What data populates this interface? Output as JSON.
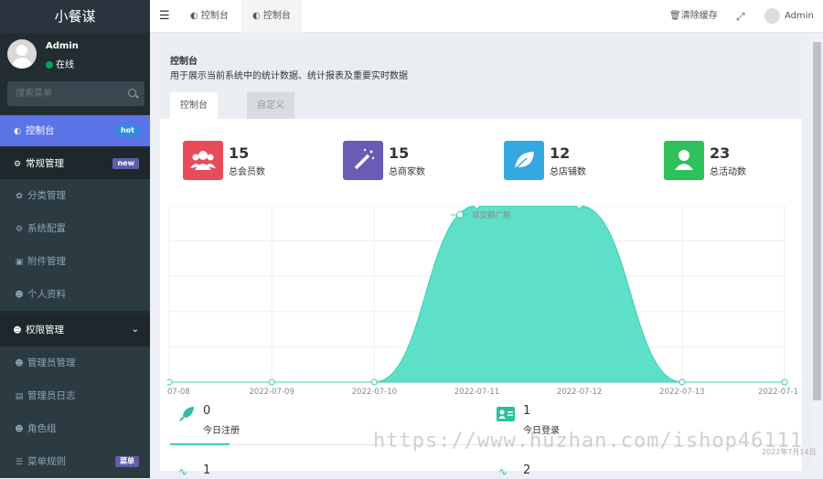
{
  "logo": "小餐谋",
  "user": {
    "name": "Admin",
    "status": "在线"
  },
  "search": {
    "placeholder": "搜索菜单"
  },
  "menu": {
    "dashboard": {
      "label": "控制台",
      "badge": "hot",
      "badge_color": "#2c8fdc"
    },
    "general": {
      "label": "常规管理",
      "badge": "new",
      "badge_color": "#605ca8"
    },
    "category": {
      "label": "分类管理"
    },
    "config": {
      "label": "系统配置"
    },
    "attachment": {
      "label": "附件管理"
    },
    "profile": {
      "label": "个人资料"
    },
    "auth": {
      "label": "权限管理"
    },
    "admin": {
      "label": "管理员管理"
    },
    "adminlog": {
      "label": "管理员日志"
    },
    "group": {
      "label": "角色组"
    },
    "rule": {
      "label": "菜单规则",
      "badge": "菜单",
      "badge_color": "#605ca8"
    }
  },
  "topbar": {
    "tab1": "控制台",
    "tab2": "控制台",
    "clear_cache": "清除缓存",
    "admin": "Admin"
  },
  "panel": {
    "title": "控制台",
    "desc": "用于展示当前系统中的统计数据、统计报表及重要实时数据",
    "tab_dashboard": "控制台",
    "tab_custom": "自定义"
  },
  "stats": [
    {
      "value": "15",
      "label": "总会员数",
      "color": "#e74c5a",
      "icon": "users-icon"
    },
    {
      "value": "15",
      "label": "总商家数",
      "color": "#6c5bb5",
      "icon": "magic-wand-icon"
    },
    {
      "value": "12",
      "label": "总店铺数",
      "color": "#35a8e0",
      "icon": "leaf-icon"
    },
    {
      "value": "23",
      "label": "总活动数",
      "color": "#2ec05a",
      "icon": "user-icon"
    }
  ],
  "chart_data": {
    "type": "area",
    "x": [
      "2022-07-08",
      "2022-07-09",
      "2022-07-10",
      "2022-07-11",
      "2022-07-12",
      "2022-07-13",
      "2022-07-14"
    ],
    "x_tick_labels": [
      "07-08",
      "2022-07-09",
      "2022-07-10",
      "2022-07-11",
      "2022-07-12",
      "2022-07-13",
      "2022-07-1"
    ],
    "series": [
      {
        "name": "成交额广数",
        "values": [
          0,
          0,
          0,
          5,
          5,
          0,
          0
        ],
        "color": "#5ee0c8",
        "line_color": "#3ccfb0"
      }
    ],
    "ylim": [
      0,
      5
    ],
    "grid": true,
    "legend": "top-center"
  },
  "bottom_stats": [
    {
      "value": "0",
      "label": "今日注册",
      "icon": "rocket-icon"
    },
    {
      "value": "1",
      "label": "今日登录",
      "icon": "id-card-icon"
    },
    {
      "value": "1",
      "label": "",
      "icon": "stat-icon"
    },
    {
      "value": "2",
      "label": "",
      "icon": "stat-icon"
    }
  ],
  "watermark": "https://www.huzhan.com/ishop46111",
  "watermark_date": "2022年7月14日"
}
